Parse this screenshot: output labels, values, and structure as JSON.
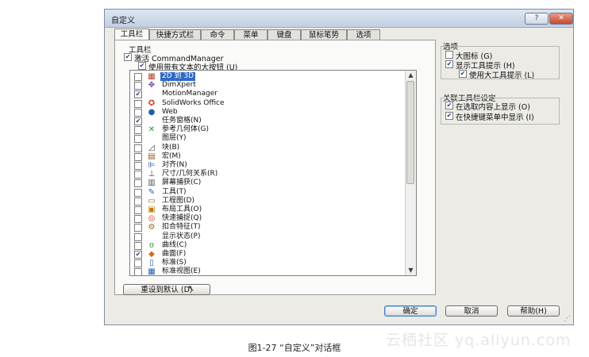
{
  "dialog": {
    "title": "自定义",
    "help_btn": "?",
    "close_btn": "✕"
  },
  "tabs": [
    "工具栏",
    "快捷方式栏",
    "命令",
    "菜单",
    "键盘",
    "鼠标笔势",
    "选项"
  ],
  "toolbar_group": {
    "label": "工具栏",
    "activate_label": "激活 CommandManager",
    "large_buttons_label": "使用带有文本的大按钮 (U)"
  },
  "toolbar_list": [
    {
      "icon": "2d-to-3d-icon",
      "glyph": "▦",
      "label": "2D 到 3D",
      "checked": false,
      "selected": true
    },
    {
      "icon": "dimxpert-icon",
      "glyph": "✥",
      "label": "DimXpert",
      "checked": false,
      "selected": false
    },
    {
      "icon": "motion-manager-icon",
      "glyph": "",
      "label": "MotionManager",
      "checked": true,
      "selected": false
    },
    {
      "icon": "solidworks-office-icon",
      "glyph": "✪",
      "label": "SolidWorks Office",
      "checked": false,
      "selected": false
    },
    {
      "icon": "web-icon",
      "glyph": "●",
      "label": "Web",
      "checked": false,
      "selected": false
    },
    {
      "icon": "task-pane-icon",
      "glyph": "",
      "label": "任务窗格(N)",
      "checked": true,
      "selected": false
    },
    {
      "icon": "reference-geometry-icon",
      "glyph": "✕",
      "label": "参考几何体(G)",
      "checked": false,
      "selected": false
    },
    {
      "icon": "layer-icon",
      "glyph": "",
      "label": "图层(Y)",
      "checked": false,
      "selected": false
    },
    {
      "icon": "block-icon",
      "glyph": "◿",
      "label": "块(B)",
      "checked": false,
      "selected": false
    },
    {
      "icon": "macro-icon",
      "glyph": "▤",
      "label": "宏(M)",
      "checked": false,
      "selected": false
    },
    {
      "icon": "align-icon",
      "glyph": "⊫",
      "label": "对齐(N)",
      "checked": false,
      "selected": false
    },
    {
      "icon": "dimension-relation-icon",
      "glyph": "⊥",
      "label": "尺寸/几何关系(R)",
      "checked": false,
      "selected": false
    },
    {
      "icon": "screen-capture-icon",
      "glyph": "▥",
      "label": "屏幕捕获(C)",
      "checked": false,
      "selected": false
    },
    {
      "icon": "tools-icon",
      "glyph": "✎",
      "label": "工具(T)",
      "checked": false,
      "selected": false
    },
    {
      "icon": "drawing-icon",
      "glyph": "▭",
      "label": "工程图(D)",
      "checked": false,
      "selected": false
    },
    {
      "icon": "layout-tools-icon",
      "glyph": "▣",
      "label": "布局工具(O)",
      "checked": false,
      "selected": false
    },
    {
      "icon": "quick-snap-icon",
      "glyph": "◎",
      "label": "快速捕捉(Q)",
      "checked": false,
      "selected": false
    },
    {
      "icon": "fastener-feature-icon",
      "glyph": "⚙",
      "label": "扣合特征(T)",
      "checked": false,
      "selected": false
    },
    {
      "icon": "display-state-icon",
      "glyph": "",
      "label": "显示状态(P)",
      "checked": false,
      "selected": false
    },
    {
      "icon": "curves-icon",
      "glyph": "ʊ",
      "label": "曲线(C)",
      "checked": false,
      "selected": false
    },
    {
      "icon": "surfaces-icon",
      "glyph": "◆",
      "label": "曲面(F)",
      "checked": true,
      "selected": false
    },
    {
      "icon": "standard-icon",
      "glyph": "▯",
      "label": "标准(S)",
      "checked": false,
      "selected": false
    },
    {
      "icon": "standard-views-icon",
      "glyph": "▦",
      "label": "标准视图(E)",
      "checked": false,
      "selected": false
    }
  ],
  "options_group": {
    "label": "选项",
    "large_icons": "大图标 (G)",
    "show_tooltips": "显示工具提示 (H)",
    "large_tooltips": "使用大工具提示 (L)"
  },
  "context_group": {
    "label": "关联工具栏设定",
    "show_in_selection": "在选取内容上显示 (O)",
    "show_in_shortcut": "在快捷键菜单中显示 (I)"
  },
  "buttons": {
    "reset": "重设到默认 (D)",
    "ok": "确定",
    "cancel": "取消",
    "help": "帮助(H)"
  },
  "caption": "图1-27 “自定义”对话框",
  "watermark": "云栖社区 yq.aliyun.com",
  "colors": {
    "selection": "#316ac5",
    "title_gradient": "#c2d0e3",
    "close": "#c44a2e"
  }
}
